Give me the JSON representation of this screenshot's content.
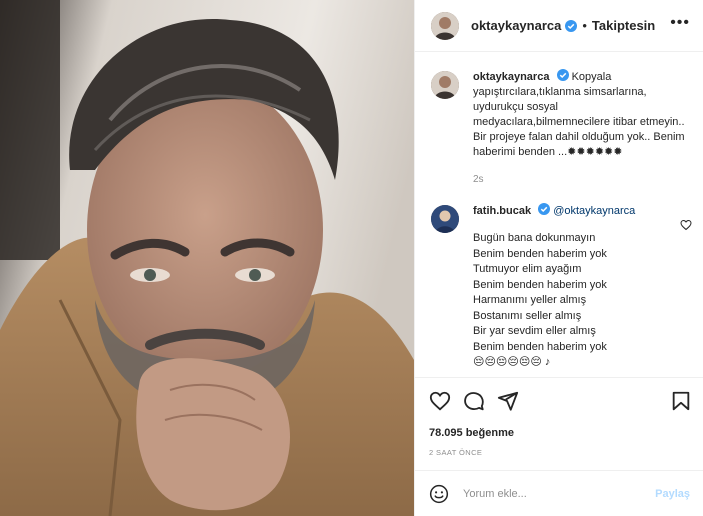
{
  "post": {
    "author": "oktaykaynarca",
    "follow_status": "Takiptesin",
    "separator": "•",
    "more_label": "•••",
    "caption": "Kopyala yapıştırcılara,tıklanma simsarlarına, uydurukçu sosyal medyacılara,bilmemnecilere itibar etmeyin.. Bir projeye falan dahil olduğum yok.. Benim haberimi benden ...✹✹✹✹✹✹",
    "caption_time": "2s"
  },
  "comment": {
    "author": "fatih.bucak",
    "mention": "@oktaykaynarca",
    "lines": [
      "Bugün bana dokunmayın",
      "Benim benden haberim yok",
      "Tutmuyor elim ayağım",
      "Benim benden haberim yok",
      "Harmanımı yeller almış",
      "Bostanımı seller almış",
      "Bir yar sevdim eller almış",
      "Benim benden haberim yok",
      "😔😔😔😔😔😔 ♪"
    ]
  },
  "actions": {
    "icons": [
      "heart-icon",
      "comment-icon",
      "share-icon",
      "bookmark-icon"
    ]
  },
  "stats": {
    "likes": "78.095 beğenme",
    "posted_ago": "2 SAAT ÖNCE"
  },
  "add_comment": {
    "placeholder": "Yorum ekle...",
    "post_label": "Paylaş"
  },
  "colors": {
    "verified": "#3897f0",
    "post_button_disabled": "#b3dbff",
    "mention": "#00376b",
    "muted": "#8e8e8e",
    "border": "#efefef"
  }
}
